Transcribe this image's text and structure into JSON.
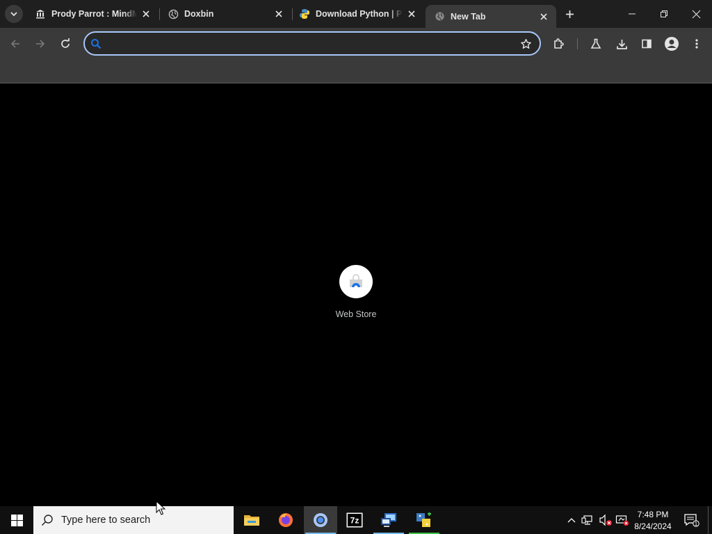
{
  "browser": {
    "tabs": [
      {
        "title": "Prody Parrot : MindMo",
        "favicon": "building-columns-icon",
        "active": false
      },
      {
        "title": "Doxbin",
        "favicon": "globe-icon",
        "active": false
      },
      {
        "title": "Download Python | Py",
        "favicon": "python-icon",
        "active": false
      },
      {
        "title": "New Tab",
        "favicon": "globe-icon",
        "active": true
      }
    ],
    "omnibox": {
      "value": "",
      "placeholder": ""
    },
    "colors": {
      "accent": "#a8c7fa",
      "tab_active": "#3a3a3a",
      "tabstrip": "#1f1f1f"
    }
  },
  "new_tab": {
    "shortcuts": [
      {
        "label": "Web Store",
        "icon": "web-store-icon"
      }
    ]
  },
  "taskbar": {
    "search_placeholder": "Type here to search",
    "apps": [
      "file-explorer-icon",
      "firefox-icon",
      "chrome-icon",
      "7zip-icon",
      "remote-desktop-icon",
      "python-installer-icon"
    ],
    "clock": {
      "time": "7:48 PM",
      "date": "8/24/2024"
    },
    "notification_count": "1"
  }
}
